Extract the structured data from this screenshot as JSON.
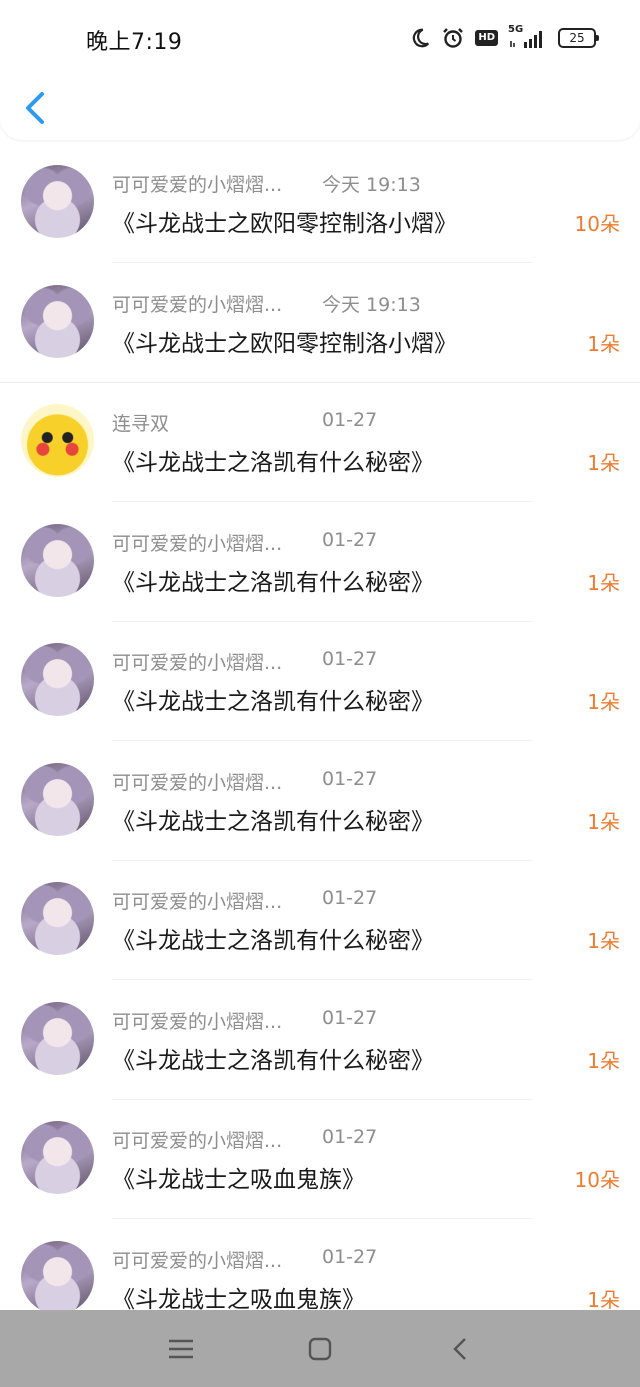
{
  "status": {
    "time": "晚上7:19",
    "network": "5G",
    "hd": "HD",
    "battery": "25"
  },
  "items": [
    {
      "name": "可可爱爱的小熠熠...",
      "time": "今天 19:13",
      "title": "《斗龙战士之欧阳零控制洛小熠》",
      "count": "10朵",
      "avatar": "anime-avatar",
      "full_divider": false
    },
    {
      "name": "可可爱爱的小熠熠...",
      "time": "今天 19:13",
      "title": "《斗龙战士之欧阳零控制洛小熠》",
      "count": "1朵",
      "avatar": "anime-avatar",
      "full_divider": true
    },
    {
      "name": "连寻双",
      "time": "01-27",
      "title": "《斗龙战士之洛凯有什么秘密》",
      "count": "1朵",
      "avatar": "pikachu-avatar",
      "full_divider": false
    },
    {
      "name": "可可爱爱的小熠熠...",
      "time": "01-27",
      "title": "《斗龙战士之洛凯有什么秘密》",
      "count": "1朵",
      "avatar": "anime-avatar",
      "full_divider": false
    },
    {
      "name": "可可爱爱的小熠熠...",
      "time": "01-27",
      "title": "《斗龙战士之洛凯有什么秘密》",
      "count": "1朵",
      "avatar": "anime-avatar",
      "full_divider": false
    },
    {
      "name": "可可爱爱的小熠熠...",
      "time": "01-27",
      "title": "《斗龙战士之洛凯有什么秘密》",
      "count": "1朵",
      "avatar": "anime-avatar",
      "full_divider": false
    },
    {
      "name": "可可爱爱的小熠熠...",
      "time": "01-27",
      "title": "《斗龙战士之洛凯有什么秘密》",
      "count": "1朵",
      "avatar": "anime-avatar",
      "full_divider": false
    },
    {
      "name": "可可爱爱的小熠熠...",
      "time": "01-27",
      "title": "《斗龙战士之洛凯有什么秘密》",
      "count": "1朵",
      "avatar": "anime-avatar",
      "full_divider": false
    },
    {
      "name": "可可爱爱的小熠熠...",
      "time": "01-27",
      "title": "《斗龙战士之吸血鬼族》",
      "count": "10朵",
      "avatar": "anime-avatar",
      "full_divider": false
    },
    {
      "name": "可可爱爱的小熠熠...",
      "time": "01-27",
      "title": "《斗龙战士之吸血鬼族》",
      "count": "1朵",
      "avatar": "anime-avatar",
      "full_divider": false
    }
  ],
  "colors": {
    "accent": "#2b9af3",
    "count": "#f07b2f",
    "meta": "#8e8e8e",
    "navbar": "#a8a8a8"
  },
  "nav": {
    "back_icon": "chevron-left-icon",
    "buttons": [
      "menu-icon",
      "home-icon",
      "back-icon"
    ]
  }
}
